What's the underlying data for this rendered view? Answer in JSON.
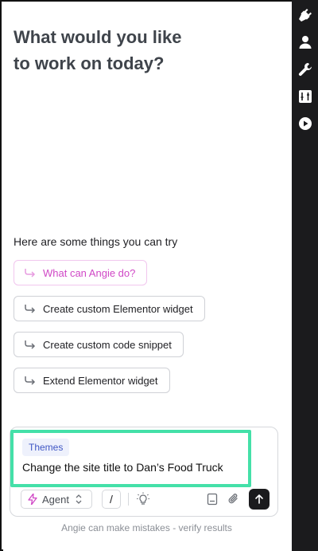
{
  "header": {
    "title_line1": "What would you like",
    "title_line2": "to work on today?"
  },
  "suggestions": {
    "label": "Here are some things you can try",
    "items": [
      {
        "label": "What can Angie do?"
      },
      {
        "label": "Create custom Elementor widget"
      },
      {
        "label": "Create custom code snippet"
      },
      {
        "label": "Extend Elementor widget"
      }
    ]
  },
  "composer": {
    "context_tag": "Themes",
    "prompt": "Change the site title to Dan’s Food Truck",
    "mode_label": "Agent",
    "slash_label": "/"
  },
  "footer": {
    "disclaimer": "Angie can make mistakes - verify results"
  },
  "rail": {
    "icons": [
      "plugin-icon",
      "user-icon",
      "wrench-icon",
      "sliders-icon",
      "play-icon"
    ]
  },
  "colors": {
    "accent_pink": "#d048c6",
    "highlight_green": "#44e0a8",
    "tag_blue": "#3f56c4",
    "rail_bg": "#1b1b1d"
  }
}
